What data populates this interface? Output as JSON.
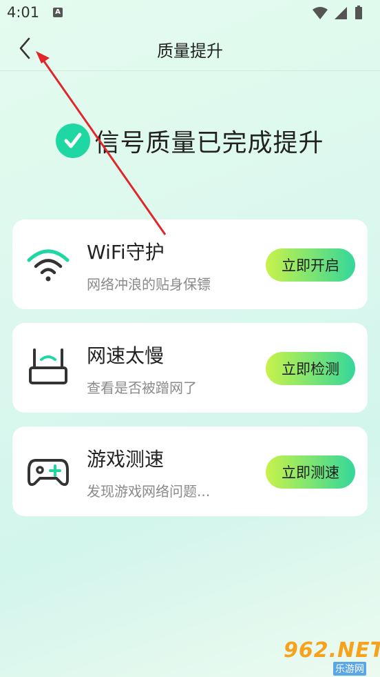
{
  "status": {
    "time": "4:01",
    "notification_letter": "A",
    "icons": [
      "wifi-icon",
      "signal-icon",
      "battery-icon"
    ]
  },
  "header": {
    "title": "质量提升",
    "back_icon": "chevron-left-icon"
  },
  "result": {
    "icon": "check-circle-icon",
    "text": "信号质量已完成提升",
    "color": "#1fd7a2"
  },
  "cards": [
    {
      "icon": "wifi-icon",
      "title": "WiFi守护",
      "subtitle": "网络冲浪的贴身保镖",
      "action": "立即开启"
    },
    {
      "icon": "router-icon",
      "title": "网速太慢",
      "subtitle": "查看是否被蹭网了",
      "action": "立即检测"
    },
    {
      "icon": "gamepad-icon",
      "title": "游戏测速",
      "subtitle": "发现游戏网络问题...",
      "action": "立即测速"
    }
  ],
  "watermark": {
    "brand": "962.NET",
    "site": "乐游网"
  },
  "colors": {
    "accent": "#1fd7a2",
    "button_gradient_start": "#c8f24a",
    "button_gradient_end": "#34d79a",
    "annotation_arrow": "#e0262a"
  }
}
